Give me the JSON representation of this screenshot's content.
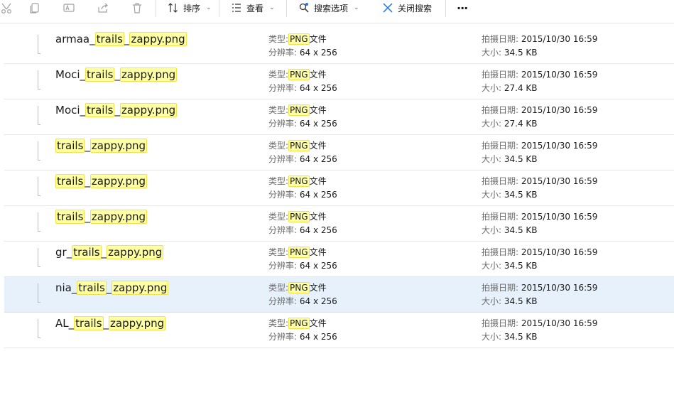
{
  "toolbar": {
    "sort_label": "排序",
    "view_label": "查看",
    "search_options_label": "搜索选项",
    "close_search_label": "关闭搜索",
    "more_label": "···"
  },
  "labels": {
    "type": "类型:",
    "type_suffix": "文件",
    "resolution": "分辨率:",
    "date_taken": "拍摄日期:",
    "size": "大小:"
  },
  "files": [
    {
      "prefix": "armaa_",
      "hl1": "trails",
      "mid": "_",
      "hl2": "zappy.png",
      "type": "PNG",
      "resolution": "64 x 256",
      "date": "2015/10/30 16:59",
      "size": "34.5 KB",
      "selected": false
    },
    {
      "prefix": "Moci_",
      "hl1": "trails",
      "mid": "_",
      "hl2": "zappy.png",
      "type": "PNG",
      "resolution": "64 x 256",
      "date": "2015/10/30 16:59",
      "size": "27.4 KB",
      "selected": false
    },
    {
      "prefix": "Moci_",
      "hl1": "trails",
      "mid": "_",
      "hl2": "zappy.png",
      "type": "PNG",
      "resolution": "64 x 256",
      "date": "2015/10/30 16:59",
      "size": "27.4 KB",
      "selected": false
    },
    {
      "prefix": "",
      "hl1": "trails",
      "mid": "_",
      "hl2": "zappy.png",
      "type": "PNG",
      "resolution": "64 x 256",
      "date": "2015/10/30 16:59",
      "size": "34.5 KB",
      "selected": false
    },
    {
      "prefix": "",
      "hl1": "trails",
      "mid": "_",
      "hl2": "zappy.png",
      "type": "PNG",
      "resolution": "64 x 256",
      "date": "2015/10/30 16:59",
      "size": "34.5 KB",
      "selected": false
    },
    {
      "prefix": "",
      "hl1": "trails",
      "mid": "_",
      "hl2": "zappy.png",
      "type": "PNG",
      "resolution": "64 x 256",
      "date": "2015/10/30 16:59",
      "size": "34.5 KB",
      "selected": false
    },
    {
      "prefix": "gr_",
      "hl1": "trails",
      "mid": "_",
      "hl2": "zappy.png",
      "type": "PNG",
      "resolution": "64 x 256",
      "date": "2015/10/30 16:59",
      "size": "34.5 KB",
      "selected": false
    },
    {
      "prefix": "nia_",
      "hl1": "trails",
      "mid": "_",
      "hl2": "zappy.png",
      "type": "PNG",
      "resolution": "64 x 256",
      "date": "2015/10/30 16:59",
      "size": "34.5 KB",
      "selected": true
    },
    {
      "prefix": "AL_",
      "hl1": "trails",
      "mid": "_",
      "hl2": "zappy.png",
      "type": "PNG",
      "resolution": "64 x 256",
      "date": "2015/10/30 16:59",
      "size": "34.5 KB",
      "selected": false
    }
  ],
  "colors": {
    "highlight": "#ffffa3",
    "selected_row": "#e6f1fb",
    "close_icon": "#1a73e8"
  }
}
